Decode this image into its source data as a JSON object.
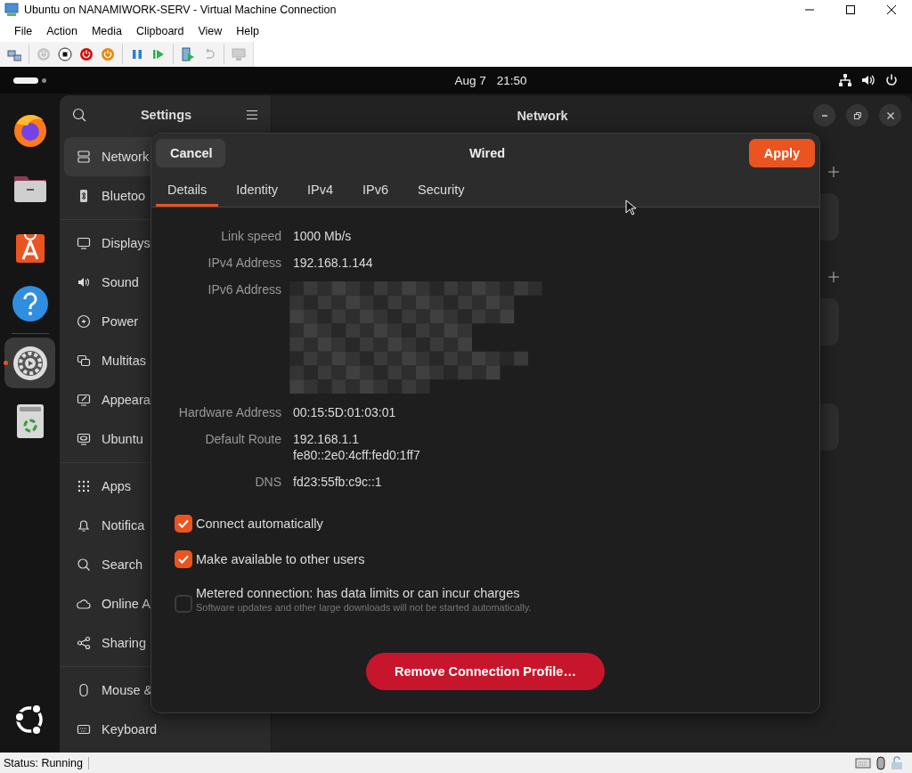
{
  "window": {
    "title": "Ubuntu on NANAMIWORK-SERV - Virtual Machine Connection"
  },
  "menu": [
    "File",
    "Action",
    "Media",
    "Clipboard",
    "View",
    "Help"
  ],
  "toolbar": [
    {
      "kind": "keys",
      "disabled": false
    },
    {
      "kind": "start",
      "disabled": true
    },
    {
      "kind": "turnoff",
      "disabled": false
    },
    {
      "kind": "shutdown",
      "disabled": false
    },
    {
      "kind": "save",
      "disabled": false
    },
    {
      "kind": "pause",
      "disabled": false
    },
    {
      "kind": "reset",
      "disabled": false
    },
    {
      "kind": "checkpoint",
      "disabled": false
    },
    {
      "kind": "revert",
      "disabled": true
    },
    {
      "kind": "enhanced",
      "disabled": true
    }
  ],
  "top_panel": {
    "date": "Aug 7",
    "time": "21:50"
  },
  "dock": [
    {
      "kind": "browser",
      "selected": false
    },
    {
      "kind": "files",
      "selected": false
    },
    {
      "kind": "store",
      "selected": false
    },
    {
      "kind": "help",
      "selected": false
    },
    {
      "kind": "settings",
      "selected": true
    },
    {
      "kind": "trash",
      "selected": false
    }
  ],
  "settings": {
    "title": "Settings",
    "page_title": "Network",
    "sidebar_groups": [
      [
        {
          "kind": "network",
          "label": "Network",
          "selected": true
        },
        {
          "kind": "bluetooth",
          "label": "Bluetoo",
          "selected": false
        }
      ],
      [
        {
          "kind": "display",
          "label": "Displays",
          "selected": false
        },
        {
          "kind": "sound",
          "label": "Sound",
          "selected": false
        },
        {
          "kind": "power",
          "label": "Power",
          "selected": false
        },
        {
          "kind": "multitasking",
          "label": "Multitas",
          "selected": false
        },
        {
          "kind": "appearance",
          "label": "Appeara",
          "selected": false
        },
        {
          "kind": "ubuntu",
          "label": "Ubuntu",
          "selected": false
        }
      ],
      [
        {
          "kind": "apps",
          "label": "Apps",
          "selected": false
        },
        {
          "kind": "notifications",
          "label": "Notifica",
          "selected": false
        },
        {
          "kind": "search",
          "label": "Search",
          "selected": false
        },
        {
          "kind": "online",
          "label": "Online A",
          "selected": false
        },
        {
          "kind": "sharing",
          "label": "Sharing",
          "selected": false
        }
      ],
      [
        {
          "kind": "mouse",
          "label": "Mouse &",
          "selected": false
        },
        {
          "kind": "keyboard",
          "label": "Keyboard",
          "selected": false
        }
      ]
    ],
    "sections": [
      {
        "add_button": true
      },
      {
        "add_button": true
      },
      {
        "add_button": false
      }
    ]
  },
  "dialog": {
    "title": "Wired",
    "cancel": "Cancel",
    "apply": "Apply",
    "tabs": [
      {
        "label": "Details",
        "selected": true
      },
      {
        "label": "Identity",
        "selected": false
      },
      {
        "label": "IPv4",
        "selected": false
      },
      {
        "label": "IPv6",
        "selected": false
      },
      {
        "label": "Security",
        "selected": false
      }
    ],
    "details": [
      {
        "kind": "text",
        "label": "Link speed",
        "values": [
          "1000 Mb/s"
        ]
      },
      {
        "kind": "text",
        "label": "IPv4 Address",
        "values": [
          "192.168.1.144"
        ]
      },
      {
        "kind": "redacted",
        "label": "IPv6 Address"
      },
      {
        "kind": "text",
        "label": "Hardware Address",
        "values": [
          "00:15:5D:01:03:01"
        ]
      },
      {
        "kind": "text",
        "label": "Default Route",
        "values": [
          "192.168.1.1",
          "fe80::2e0:4cff:fed0:1ff7"
        ]
      },
      {
        "kind": "text",
        "label": "DNS",
        "values": [
          "fd23:55fb:c9c::1"
        ]
      }
    ],
    "options": [
      {
        "label": "Connect automatically",
        "checked": true
      },
      {
        "label": "Make available to other users",
        "checked": true
      },
      {
        "label": "Metered connection: has data limits or can incur charges",
        "hint": "Software updates and other large downloads will not be started automatically.",
        "checked": false
      }
    ],
    "remove": "Remove Connection Profile…"
  },
  "status_bar": {
    "status": "Status: Running"
  }
}
